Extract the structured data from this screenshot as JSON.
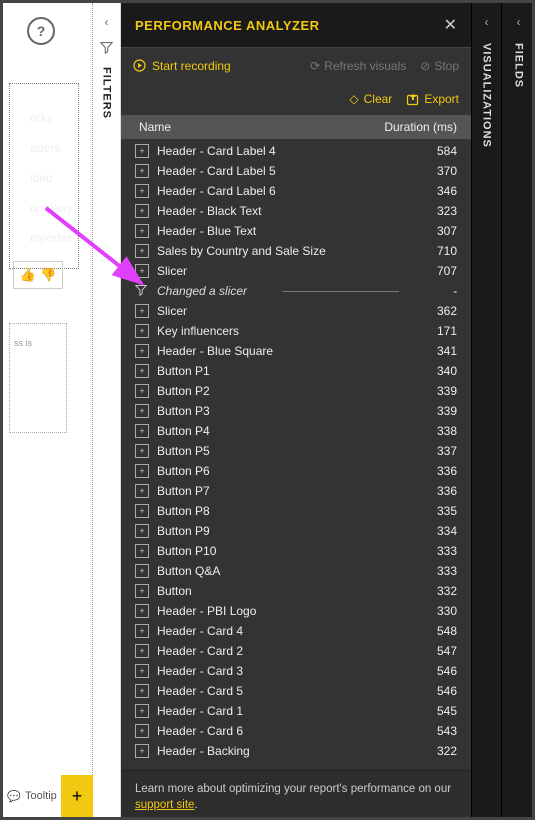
{
  "canvas": {
    "fragments": [
      "orks",
      "aders",
      "ideo",
      "ompany",
      "mporters"
    ],
    "frag2": "ss is"
  },
  "footer": {
    "tooltip": "Tooltip",
    "add": "+"
  },
  "rails": {
    "filters": "FILTERS",
    "visualizations": "VISUALIZATIONS",
    "fields": "FIELDS"
  },
  "perf": {
    "title": "PERFORMANCE ANALYZER",
    "start": "Start recording",
    "refresh": "Refresh visuals",
    "stop": "Stop",
    "clear": "Clear",
    "export": "Export",
    "col_name": "Name",
    "col_dur": "Duration (ms)",
    "help_pre": "Learn more about optimizing your report's performance on our ",
    "help_link": "support site",
    "help_post": ".",
    "rows": [
      {
        "t": "v",
        "name": "Header - Card Label 4",
        "dur": "584"
      },
      {
        "t": "v",
        "name": "Header - Card Label 5",
        "dur": "370"
      },
      {
        "t": "v",
        "name": "Header - Card Label 6",
        "dur": "346"
      },
      {
        "t": "v",
        "name": "Header - Black Text",
        "dur": "323"
      },
      {
        "t": "v",
        "name": "Header - Blue Text",
        "dur": "307"
      },
      {
        "t": "v",
        "name": "Sales by Country and Sale Size",
        "dur": "710"
      },
      {
        "t": "v",
        "name": "Slicer",
        "dur": "707"
      },
      {
        "t": "e",
        "name": "Changed a slicer",
        "dur": "-"
      },
      {
        "t": "v",
        "name": "Slicer",
        "dur": "362"
      },
      {
        "t": "v",
        "name": "Key influencers",
        "dur": "171"
      },
      {
        "t": "v",
        "name": "Header - Blue Square",
        "dur": "341"
      },
      {
        "t": "v",
        "name": "Button P1",
        "dur": "340"
      },
      {
        "t": "v",
        "name": "Button P2",
        "dur": "339"
      },
      {
        "t": "v",
        "name": "Button P3",
        "dur": "339"
      },
      {
        "t": "v",
        "name": "Button P4",
        "dur": "338"
      },
      {
        "t": "v",
        "name": "Button P5",
        "dur": "337"
      },
      {
        "t": "v",
        "name": "Button P6",
        "dur": "336"
      },
      {
        "t": "v",
        "name": "Button P7",
        "dur": "336"
      },
      {
        "t": "v",
        "name": "Button P8",
        "dur": "335"
      },
      {
        "t": "v",
        "name": "Button P9",
        "dur": "334"
      },
      {
        "t": "v",
        "name": "Button P10",
        "dur": "333"
      },
      {
        "t": "v",
        "name": "Button Q&A",
        "dur": "333"
      },
      {
        "t": "v",
        "name": "Button",
        "dur": "332"
      },
      {
        "t": "v",
        "name": "Header - PBI Logo",
        "dur": "330"
      },
      {
        "t": "v",
        "name": "Header - Card 4",
        "dur": "548"
      },
      {
        "t": "v",
        "name": "Header - Card 2",
        "dur": "547"
      },
      {
        "t": "v",
        "name": "Header - Card 3",
        "dur": "546"
      },
      {
        "t": "v",
        "name": "Header - Card 5",
        "dur": "546"
      },
      {
        "t": "v",
        "name": "Header - Card 1",
        "dur": "545"
      },
      {
        "t": "v",
        "name": "Header - Card 6",
        "dur": "543"
      },
      {
        "t": "v",
        "name": "Header - Backing",
        "dur": "322"
      }
    ]
  }
}
